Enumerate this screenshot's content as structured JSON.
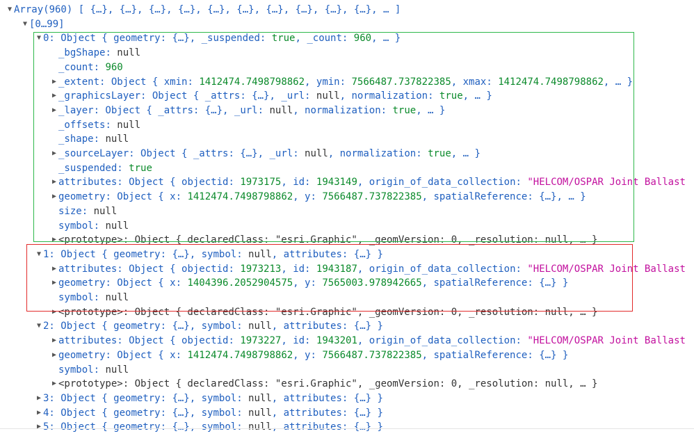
{
  "colors": {
    "green_box": "#2db84a",
    "red_box": "#e22a2a",
    "key": "#1f5fbf",
    "number": "#0b8a2b",
    "string": "#c2109e"
  },
  "lines": [
    {
      "indent": 0,
      "tw": "down",
      "parts": [
        [
          "p",
          "Array(960) [ {…}, {…}, {…}, {…}, {…}, {…}, {…}, {…}, {…}, {…}, … ]"
        ]
      ]
    },
    {
      "indent": 1,
      "tw": "down",
      "parts": [
        [
          "p",
          "[0…99]"
        ]
      ]
    },
    {
      "indent": 2,
      "tw": "down",
      "parts": [
        [
          "k",
          "0: Object { "
        ],
        [
          "k",
          "geometry"
        ],
        [
          "p",
          ": {…}, "
        ],
        [
          "k",
          "_suspended"
        ],
        [
          "p",
          ": "
        ],
        [
          "bool",
          "true"
        ],
        [
          "p",
          ", "
        ],
        [
          "k",
          "_count"
        ],
        [
          "p",
          ": "
        ],
        [
          "num",
          "960"
        ],
        [
          "p",
          ", … }"
        ]
      ]
    },
    {
      "indent": 3,
      "tw": "none",
      "parts": [
        [
          "k",
          "_bgShape"
        ],
        [
          "p",
          ": "
        ],
        [
          "nul",
          "null"
        ]
      ]
    },
    {
      "indent": 3,
      "tw": "none",
      "parts": [
        [
          "k",
          "_count"
        ],
        [
          "p",
          ": "
        ],
        [
          "num",
          "960"
        ]
      ]
    },
    {
      "indent": 3,
      "tw": "right",
      "parts": [
        [
          "k",
          "_extent"
        ],
        [
          "p",
          ": Object { "
        ],
        [
          "k",
          "xmin"
        ],
        [
          "p",
          ": "
        ],
        [
          "num",
          "1412474.7498798862"
        ],
        [
          "p",
          ", "
        ],
        [
          "k",
          "ymin"
        ],
        [
          "p",
          ": "
        ],
        [
          "num",
          "7566487.737822385"
        ],
        [
          "p",
          ", "
        ],
        [
          "k",
          "xmax"
        ],
        [
          "p",
          ": "
        ],
        [
          "num",
          "1412474.7498798862"
        ],
        [
          "p",
          ", … }"
        ]
      ]
    },
    {
      "indent": 3,
      "tw": "right",
      "parts": [
        [
          "k",
          "_graphicsLayer"
        ],
        [
          "p",
          ": Object { "
        ],
        [
          "k",
          "_attrs"
        ],
        [
          "p",
          ": {…}, "
        ],
        [
          "k",
          "_url"
        ],
        [
          "p",
          ": "
        ],
        [
          "nul",
          "null"
        ],
        [
          "p",
          ", "
        ],
        [
          "k",
          "normalization"
        ],
        [
          "p",
          ": "
        ],
        [
          "bool",
          "true"
        ],
        [
          "p",
          ", … }"
        ]
      ]
    },
    {
      "indent": 3,
      "tw": "right",
      "parts": [
        [
          "k",
          "_layer"
        ],
        [
          "p",
          ": Object { "
        ],
        [
          "k",
          "_attrs"
        ],
        [
          "p",
          ": {…}, "
        ],
        [
          "k",
          "_url"
        ],
        [
          "p",
          ": "
        ],
        [
          "nul",
          "null"
        ],
        [
          "p",
          ", "
        ],
        [
          "k",
          "normalization"
        ],
        [
          "p",
          ": "
        ],
        [
          "bool",
          "true"
        ],
        [
          "p",
          ", … }"
        ]
      ]
    },
    {
      "indent": 3,
      "tw": "none",
      "parts": [
        [
          "k",
          "_offsets"
        ],
        [
          "p",
          ": "
        ],
        [
          "nul",
          "null"
        ]
      ]
    },
    {
      "indent": 3,
      "tw": "none",
      "parts": [
        [
          "k",
          "_shape"
        ],
        [
          "p",
          ": "
        ],
        [
          "nul",
          "null"
        ]
      ]
    },
    {
      "indent": 3,
      "tw": "right",
      "parts": [
        [
          "k",
          "_sourceLayer"
        ],
        [
          "p",
          ": Object { "
        ],
        [
          "k",
          "_attrs"
        ],
        [
          "p",
          ": {…}, "
        ],
        [
          "k",
          "_url"
        ],
        [
          "p",
          ": "
        ],
        [
          "nul",
          "null"
        ],
        [
          "p",
          ", "
        ],
        [
          "k",
          "normalization"
        ],
        [
          "p",
          ": "
        ],
        [
          "bool",
          "true"
        ],
        [
          "p",
          ", … }"
        ]
      ]
    },
    {
      "indent": 3,
      "tw": "none",
      "parts": [
        [
          "k",
          "_suspended"
        ],
        [
          "p",
          ": "
        ],
        [
          "bool",
          "true"
        ]
      ]
    },
    {
      "indent": 3,
      "tw": "right",
      "parts": [
        [
          "k",
          "attributes"
        ],
        [
          "p",
          ": Object { "
        ],
        [
          "k",
          "objectid"
        ],
        [
          "p",
          ": "
        ],
        [
          "num",
          "1973175"
        ],
        [
          "p",
          ", "
        ],
        [
          "k",
          "id"
        ],
        [
          "p",
          ": "
        ],
        [
          "num",
          "1943149"
        ],
        [
          "p",
          ", "
        ],
        [
          "k",
          "origin_of_data_collection"
        ],
        [
          "p",
          ": "
        ],
        [
          "str",
          "\"HELCOM/OSPAR Joint Ballast"
        ]
      ]
    },
    {
      "indent": 3,
      "tw": "right",
      "parts": [
        [
          "k",
          "geometry"
        ],
        [
          "p",
          ": Object { "
        ],
        [
          "k",
          "x"
        ],
        [
          "p",
          ": "
        ],
        [
          "num",
          "1412474.7498798862"
        ],
        [
          "p",
          ", "
        ],
        [
          "k",
          "y"
        ],
        [
          "p",
          ": "
        ],
        [
          "num",
          "7566487.737822385"
        ],
        [
          "p",
          ", "
        ],
        [
          "k",
          "spatialReference"
        ],
        [
          "p",
          ": {…}, … }"
        ]
      ]
    },
    {
      "indent": 3,
      "tw": "none",
      "parts": [
        [
          "k",
          "size"
        ],
        [
          "p",
          ": "
        ],
        [
          "nul",
          "null"
        ]
      ]
    },
    {
      "indent": 3,
      "tw": "none",
      "parts": [
        [
          "k",
          "symbol"
        ],
        [
          "p",
          ": "
        ],
        [
          "nul",
          "null"
        ]
      ]
    },
    {
      "indent": 3,
      "tw": "right",
      "parts": [
        [
          "nul",
          "<prototype>: Object { declaredClass: \"esri.Graphic\", _geomVersion: 0, _resolution: null, … }"
        ]
      ]
    },
    {
      "indent": 2,
      "tw": "down",
      "parts": [
        [
          "k",
          "1: Object { "
        ],
        [
          "k",
          "geometry"
        ],
        [
          "p",
          ": {…}, "
        ],
        [
          "k",
          "symbol"
        ],
        [
          "p",
          ": "
        ],
        [
          "nul",
          "null"
        ],
        [
          "p",
          ", "
        ],
        [
          "k",
          "attributes"
        ],
        [
          "p",
          ": {…} }"
        ]
      ]
    },
    {
      "indent": 3,
      "tw": "right",
      "parts": [
        [
          "k",
          "attributes"
        ],
        [
          "p",
          ": Object { "
        ],
        [
          "k",
          "objectid"
        ],
        [
          "p",
          ": "
        ],
        [
          "num",
          "1973213"
        ],
        [
          "p",
          ", "
        ],
        [
          "k",
          "id"
        ],
        [
          "p",
          ": "
        ],
        [
          "num",
          "1943187"
        ],
        [
          "p",
          ", "
        ],
        [
          "k",
          "origin_of_data_collection"
        ],
        [
          "p",
          ": "
        ],
        [
          "str",
          "\"HELCOM/OSPAR Joint Ballast"
        ]
      ]
    },
    {
      "indent": 3,
      "tw": "right",
      "parts": [
        [
          "k",
          "geometry"
        ],
        [
          "p",
          ": Object { "
        ],
        [
          "k",
          "x"
        ],
        [
          "p",
          ": "
        ],
        [
          "num",
          "1404396.2052904575"
        ],
        [
          "p",
          ", "
        ],
        [
          "k",
          "y"
        ],
        [
          "p",
          ": "
        ],
        [
          "num",
          "7565003.978942665"
        ],
        [
          "p",
          ", "
        ],
        [
          "k",
          "spatialReference"
        ],
        [
          "p",
          ": {…} }"
        ]
      ]
    },
    {
      "indent": 3,
      "tw": "none",
      "parts": [
        [
          "k",
          "symbol"
        ],
        [
          "p",
          ": "
        ],
        [
          "nul",
          "null"
        ]
      ]
    },
    {
      "indent": 3,
      "tw": "right",
      "parts": [
        [
          "nul",
          "<prototype>: Object { declaredClass: \"esri.Graphic\", _geomVersion: 0, _resolution: null, … }"
        ]
      ]
    },
    {
      "indent": 2,
      "tw": "down",
      "parts": [
        [
          "k",
          "2: Object { "
        ],
        [
          "k",
          "geometry"
        ],
        [
          "p",
          ": {…}, "
        ],
        [
          "k",
          "symbol"
        ],
        [
          "p",
          ": "
        ],
        [
          "nul",
          "null"
        ],
        [
          "p",
          ", "
        ],
        [
          "k",
          "attributes"
        ],
        [
          "p",
          ": {…} }"
        ]
      ]
    },
    {
      "indent": 3,
      "tw": "right",
      "parts": [
        [
          "k",
          "attributes"
        ],
        [
          "p",
          ": Object { "
        ],
        [
          "k",
          "objectid"
        ],
        [
          "p",
          ": "
        ],
        [
          "num",
          "1973227"
        ],
        [
          "p",
          ", "
        ],
        [
          "k",
          "id"
        ],
        [
          "p",
          ": "
        ],
        [
          "num",
          "1943201"
        ],
        [
          "p",
          ", "
        ],
        [
          "k",
          "origin_of_data_collection"
        ],
        [
          "p",
          ": "
        ],
        [
          "str",
          "\"HELCOM/OSPAR Joint Ballast"
        ]
      ]
    },
    {
      "indent": 3,
      "tw": "right",
      "parts": [
        [
          "k",
          "geometry"
        ],
        [
          "p",
          ": Object { "
        ],
        [
          "k",
          "x"
        ],
        [
          "p",
          ": "
        ],
        [
          "num",
          "1412474.7498798862"
        ],
        [
          "p",
          ", "
        ],
        [
          "k",
          "y"
        ],
        [
          "p",
          ": "
        ],
        [
          "num",
          "7566487.737822385"
        ],
        [
          "p",
          ", "
        ],
        [
          "k",
          "spatialReference"
        ],
        [
          "p",
          ": {…} }"
        ]
      ]
    },
    {
      "indent": 3,
      "tw": "none",
      "parts": [
        [
          "k",
          "symbol"
        ],
        [
          "p",
          ": "
        ],
        [
          "nul",
          "null"
        ]
      ]
    },
    {
      "indent": 3,
      "tw": "right",
      "parts": [
        [
          "nul",
          "<prototype>: Object { declaredClass: \"esri.Graphic\", _geomVersion: 0, _resolution: null, … }"
        ]
      ]
    },
    {
      "indent": 2,
      "tw": "right",
      "parts": [
        [
          "k",
          "3: Object { "
        ],
        [
          "k",
          "geometry"
        ],
        [
          "p",
          ": {…}, "
        ],
        [
          "k",
          "symbol"
        ],
        [
          "p",
          ": "
        ],
        [
          "nul",
          "null"
        ],
        [
          "p",
          ", "
        ],
        [
          "k",
          "attributes"
        ],
        [
          "p",
          ": {…} }"
        ]
      ]
    },
    {
      "indent": 2,
      "tw": "right",
      "parts": [
        [
          "k",
          "4: Object { "
        ],
        [
          "k",
          "geometry"
        ],
        [
          "p",
          ": {…}, "
        ],
        [
          "k",
          "symbol"
        ],
        [
          "p",
          ": "
        ],
        [
          "nul",
          "null"
        ],
        [
          "p",
          ", "
        ],
        [
          "k",
          "attributes"
        ],
        [
          "p",
          ": {…} }"
        ]
      ]
    },
    {
      "indent": 2,
      "tw": "right",
      "parts": [
        [
          "k",
          "5: Object { "
        ],
        [
          "k",
          "geometry"
        ],
        [
          "p",
          ": {…}, "
        ],
        [
          "k",
          "symbol"
        ],
        [
          "p",
          ": "
        ],
        [
          "nul",
          "null"
        ],
        [
          "p",
          ", "
        ],
        [
          "k",
          "attributes"
        ],
        [
          "p",
          ": {…} }"
        ]
      ]
    }
  ]
}
